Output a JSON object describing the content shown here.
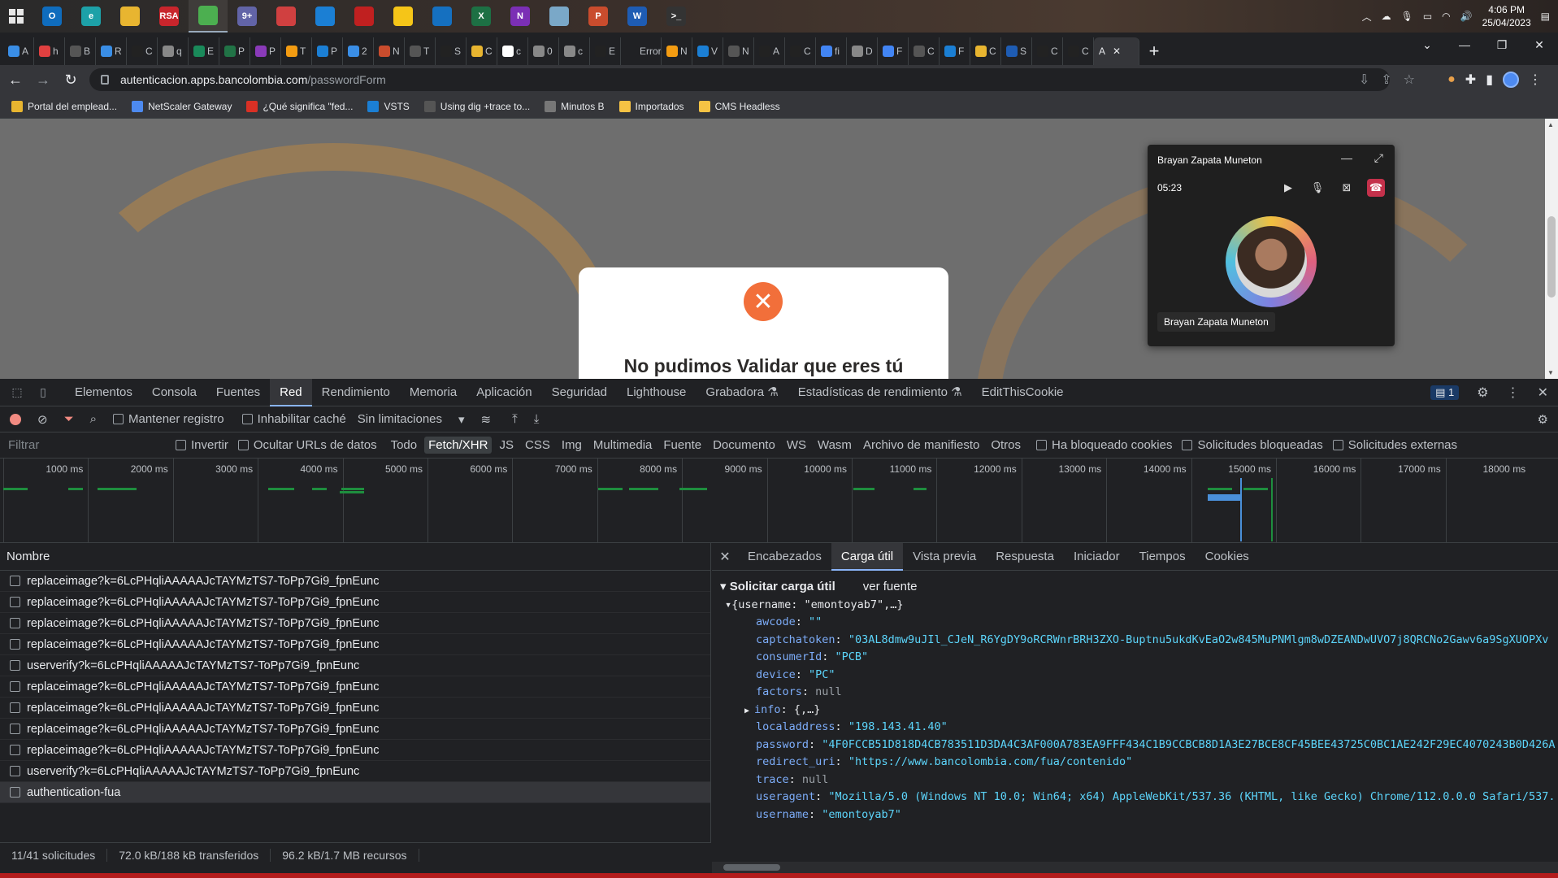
{
  "taskbar": {
    "apps": [
      {
        "name": "outlook",
        "label": "O",
        "color": "#0f6cbd"
      },
      {
        "name": "edge",
        "label": "e",
        "color": "#1da1a8"
      },
      {
        "name": "explorer",
        "label": "",
        "color": "#e8b530"
      },
      {
        "name": "rsa",
        "label": "RSA",
        "color": "#c8252c"
      },
      {
        "name": "chrome",
        "label": "",
        "color": "#4caf50"
      },
      {
        "name": "teams",
        "label": "9+",
        "color": "#6264a7"
      },
      {
        "name": "vpn",
        "label": "",
        "color": "#d04040"
      },
      {
        "name": "vscode",
        "label": "",
        "color": "#1b7fd4"
      },
      {
        "name": "app8",
        "label": "",
        "color": "#c02020"
      },
      {
        "name": "sticky-notes",
        "label": "",
        "color": "#f5c518"
      },
      {
        "name": "webex",
        "label": "",
        "color": "#1570c0"
      },
      {
        "name": "excel",
        "label": "X",
        "color": "#1d7044"
      },
      {
        "name": "onenote",
        "label": "N",
        "color": "#7b2fb5"
      },
      {
        "name": "app13",
        "label": "",
        "color": "#7aa8c8"
      },
      {
        "name": "powerpoint",
        "label": "P",
        "color": "#c94c2d"
      },
      {
        "name": "word",
        "label": "W",
        "color": "#1e5cb3"
      },
      {
        "name": "terminal",
        "label": ">_",
        "color": "#333333"
      }
    ],
    "time": "4:06 PM",
    "date": "25/04/2023"
  },
  "tabs": [
    {
      "label": "A",
      "color": "#3a8ee6"
    },
    {
      "label": "h",
      "color": "#e04040"
    },
    {
      "label": "B",
      "color": "#555"
    },
    {
      "label": "R",
      "color": "#3a8ee6"
    },
    {
      "label": "C",
      "color": "#222"
    },
    {
      "label": "q",
      "color": "#888"
    },
    {
      "label": "E",
      "color": "#1a8a5a"
    },
    {
      "label": "P",
      "color": "#217346"
    },
    {
      "label": "P",
      "color": "#8a3ab9"
    },
    {
      "label": "T",
      "color": "#f39c12"
    },
    {
      "label": "P",
      "color": "#1b7fd4"
    },
    {
      "label": "2",
      "color": "#3a8ee6"
    },
    {
      "label": "N",
      "color": "#c94c2d"
    },
    {
      "label": "T",
      "color": "#555"
    },
    {
      "label": "S",
      "color": "#222"
    },
    {
      "label": "C",
      "color": "#e8b530"
    },
    {
      "label": "c",
      "color": "#ffffff"
    },
    {
      "label": "0",
      "color": "#888"
    },
    {
      "label": "c",
      "color": "#888"
    },
    {
      "label": "E",
      "color": "#222"
    },
    {
      "label": "Error",
      "color": "#202124"
    },
    {
      "label": "N",
      "color": "#f39c12"
    },
    {
      "label": "V",
      "color": "#1b7fd4"
    },
    {
      "label": "N",
      "color": "#555"
    },
    {
      "label": "A",
      "color": "#222"
    },
    {
      "label": "C",
      "color": "#222"
    },
    {
      "label": "fi",
      "color": "#4285f4"
    },
    {
      "label": "D",
      "color": "#888"
    },
    {
      "label": "F",
      "color": "#4285f4"
    },
    {
      "label": "C",
      "color": "#555"
    },
    {
      "label": "F",
      "color": "#1b7fd4"
    },
    {
      "label": "C",
      "color": "#e8b530"
    },
    {
      "label": "S",
      "color": "#1e5cb3"
    },
    {
      "label": "C",
      "color": "#222"
    },
    {
      "label": "C",
      "color": "#222"
    }
  ],
  "active_tab": {
    "label": "A"
  },
  "address": {
    "host": "autenticacion.apps.bancolombia.com",
    "path": "/passwordForm"
  },
  "bookmarks": [
    {
      "label": "Portal del emplead...",
      "color": "#e8b530"
    },
    {
      "label": "NetScaler Gateway",
      "color": "#4d8af0"
    },
    {
      "label": "¿Qué significa \"fed...",
      "color": "#d93025"
    },
    {
      "label": "VSTS",
      "color": "#1b7fd4"
    },
    {
      "label": "Using dig +trace to...",
      "color": "#555"
    },
    {
      "label": "Minutos B",
      "color": "#777"
    },
    {
      "label": "Importados",
      "color": "#f6c344"
    },
    {
      "label": "CMS Headless",
      "color": "#f6c344"
    }
  ],
  "modal": {
    "title": "No pudimos Validar que eres tú"
  },
  "call": {
    "name": "Brayan Zapata Muneton",
    "duration": "05:23",
    "label": "Brayan Zapata Muneton"
  },
  "devtools": {
    "tabs": [
      "Elementos",
      "Consola",
      "Fuentes",
      "Red",
      "Rendimiento",
      "Memoria",
      "Aplicación",
      "Seguridad",
      "Lighthouse",
      "Grabadora ⚗",
      "Estadísticas de rendimiento ⚗",
      "EditThisCookie"
    ],
    "active_tab": "Red",
    "issues_count": "1",
    "controls": {
      "preserve_log": "Mantener registro",
      "disable_cache": "Inhabilitar caché",
      "throttling": "Sin limitaciones"
    },
    "filter": {
      "placeholder": "Filtrar",
      "invert": "Invertir",
      "hide_data_urls": "Ocultar URLs de datos",
      "types": [
        "Todo",
        "Fetch/XHR",
        "JS",
        "CSS",
        "Img",
        "Multimedia",
        "Fuente",
        "Documento",
        "WS",
        "Wasm",
        "Archivo de manifiesto",
        "Otros"
      ],
      "active_type": "Fetch/XHR",
      "blocked_cookies": "Ha bloqueado cookies",
      "blocked_requests": "Solicitudes bloqueadas",
      "third_party": "Solicitudes externas"
    },
    "timeline_ticks": [
      "1000 ms",
      "2000 ms",
      "3000 ms",
      "4000 ms",
      "5000 ms",
      "6000 ms",
      "7000 ms",
      "8000 ms",
      "9000 ms",
      "10000 ms",
      "11000 ms",
      "12000 ms",
      "13000 ms",
      "14000 ms",
      "15000 ms",
      "16000 ms",
      "17000 ms",
      "18000 ms"
    ],
    "requests_header": "Nombre",
    "requests": [
      "replaceimage?k=6LcPHqliAAAAAJcTAYMzTS7-ToPp7Gi9_fpnEunc",
      "replaceimage?k=6LcPHqliAAAAAJcTAYMzTS7-ToPp7Gi9_fpnEunc",
      "replaceimage?k=6LcPHqliAAAAAJcTAYMzTS7-ToPp7Gi9_fpnEunc",
      "replaceimage?k=6LcPHqliAAAAAJcTAYMzTS7-ToPp7Gi9_fpnEunc",
      "userverify?k=6LcPHqliAAAAAJcTAYMzTS7-ToPp7Gi9_fpnEunc",
      "replaceimage?k=6LcPHqliAAAAAJcTAYMzTS7-ToPp7Gi9_fpnEunc",
      "replaceimage?k=6LcPHqliAAAAAJcTAYMzTS7-ToPp7Gi9_fpnEunc",
      "replaceimage?k=6LcPHqliAAAAAJcTAYMzTS7-ToPp7Gi9_fpnEunc",
      "replaceimage?k=6LcPHqliAAAAAJcTAYMzTS7-ToPp7Gi9_fpnEunc",
      "userverify?k=6LcPHqliAAAAAJcTAYMzTS7-ToPp7Gi9_fpnEunc",
      "authentication-fua"
    ],
    "selected_request": 10,
    "status": {
      "requests": "11/41 solicitudes",
      "transferred": "72.0 kB/188 kB transferidos",
      "resources": "96.2 kB/1.7 MB recursos"
    },
    "detail_tabs": [
      "Encabezados",
      "Carga útil",
      "Vista previa",
      "Respuesta",
      "Iniciador",
      "Tiempos",
      "Cookies"
    ],
    "active_detail_tab": "Carga útil",
    "payload": {
      "section_title": "Solicitar carga útil",
      "view_source": "ver fuente",
      "summary": "{username: \"emontoyab7\",…}",
      "fields": [
        {
          "key": "awcode",
          "value": "\"\"",
          "kind": "s"
        },
        {
          "key": "captchatoken",
          "value": "\"03AL8dmw9uJIl_CJeN_R6YgDY9oRCRWnrBRH3ZXO-Buptnu5ukdKvEaO2w845MuPNMlgm8wDZEANDwUVO7j8QRCNo2Gawv6a9SgXUOPXv",
          "kind": "s"
        },
        {
          "key": "consumerId",
          "value": "\"PCB\"",
          "kind": "s"
        },
        {
          "key": "device",
          "value": "\"PC\"",
          "kind": "s"
        },
        {
          "key": "factors",
          "value": "null",
          "kind": "n"
        },
        {
          "key": "info",
          "value": "{,…}",
          "kind": "o"
        },
        {
          "key": "localaddress",
          "value": "\"198.143.41.40\"",
          "kind": "s"
        },
        {
          "key": "password",
          "value": "\"4F0FCCB51D818D4CB783511D3DA4C3AF000A783EA9FFF434C1B9CCBCB8D1A3E27BCE8CF45BEE43725C0BC1AE242F29EC4070243B0D426A",
          "kind": "s"
        },
        {
          "key": "redirect_uri",
          "value": "\"https://www.bancolombia.com/fua/contenido\"",
          "kind": "s"
        },
        {
          "key": "trace",
          "value": "null",
          "kind": "n"
        },
        {
          "key": "useragent",
          "value": "\"Mozilla/5.0 (Windows NT 10.0; Win64; x64) AppleWebKit/537.36 (KHTML, like Gecko) Chrome/112.0.0.0 Safari/537.",
          "kind": "s"
        },
        {
          "key": "username",
          "value": "\"emontoyab7\"",
          "kind": "s"
        }
      ]
    }
  }
}
